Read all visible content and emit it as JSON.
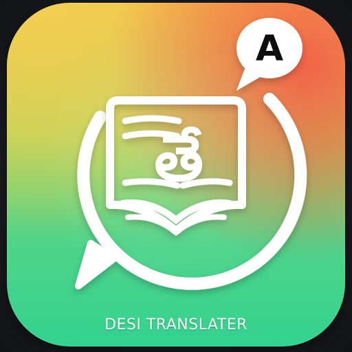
{
  "app_icon": {
    "name_label": "DESI TRANSLATER",
    "badge_letter": "A",
    "script_glyph": "తే",
    "icons": [
      "speech-bubble-icon",
      "book-icon",
      "letter-a-badge-icon"
    ],
    "colors": {
      "gradient_top": "#f2c94c",
      "gradient_bottom": "#33d38f",
      "gradient_accent": "#f45d48",
      "foreground": "#ffffff",
      "badge_text": "#111111"
    }
  }
}
